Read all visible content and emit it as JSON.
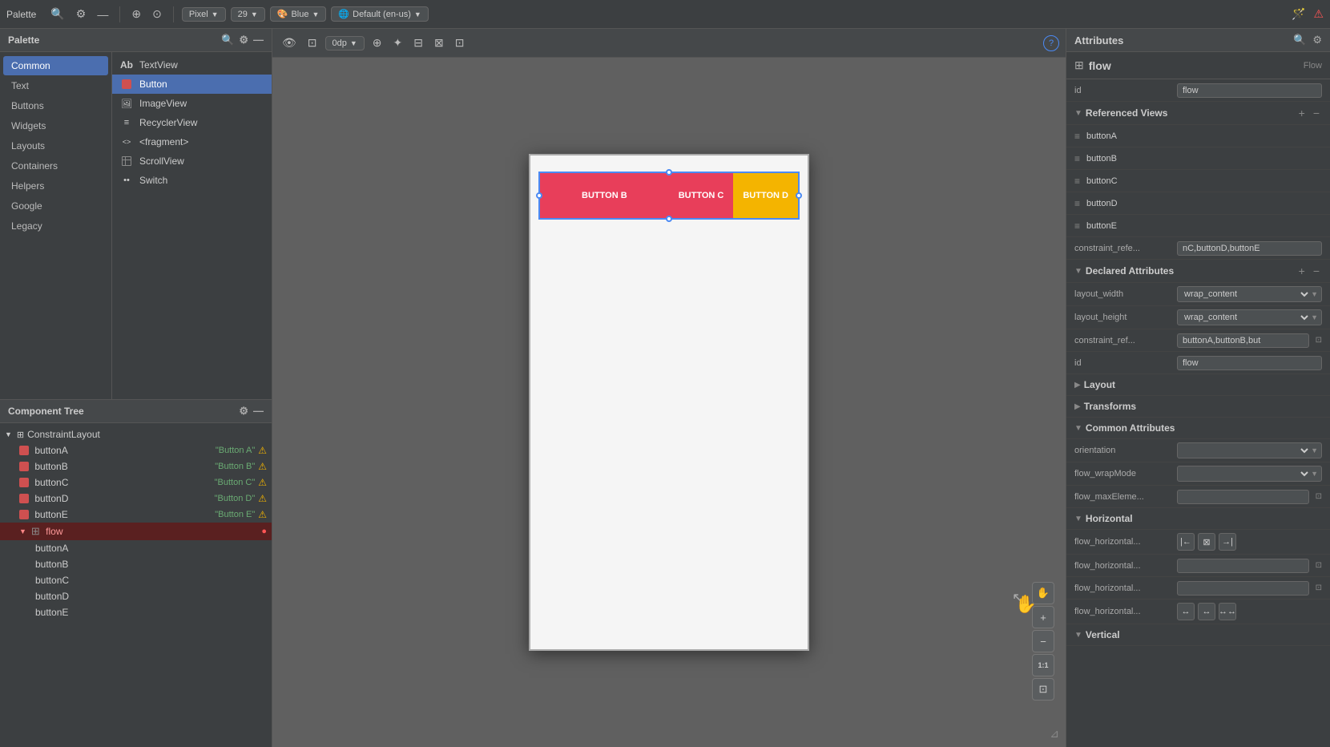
{
  "topbar": {
    "title": "Palette",
    "tools": {
      "pixel_label": "Pixel",
      "zoom_label": "29",
      "theme_label": "Blue",
      "locale_label": "Default (en-us)",
      "help_icon": "?",
      "error_icon": "⚠"
    }
  },
  "palette": {
    "categories": [
      {
        "id": "common",
        "label": "Common",
        "active": true
      },
      {
        "id": "text",
        "label": "Text"
      },
      {
        "id": "buttons",
        "label": "Buttons"
      },
      {
        "id": "widgets",
        "label": "Widgets"
      },
      {
        "id": "layouts",
        "label": "Layouts"
      },
      {
        "id": "containers",
        "label": "Containers"
      },
      {
        "id": "helpers",
        "label": "Helpers"
      },
      {
        "id": "google",
        "label": "Google"
      },
      {
        "id": "legacy",
        "label": "Legacy"
      }
    ],
    "items": [
      {
        "id": "textview",
        "label": "TextView",
        "icon": "Ab"
      },
      {
        "id": "button",
        "label": "Button",
        "icon": "▣",
        "selected": true
      },
      {
        "id": "imageview",
        "label": "ImageView",
        "icon": "🖼"
      },
      {
        "id": "recyclerview",
        "label": "RecyclerView",
        "icon": "≡"
      },
      {
        "id": "fragment",
        "label": "<fragment>",
        "icon": "<>"
      },
      {
        "id": "scrollview",
        "label": "ScrollView",
        "icon": "▣"
      },
      {
        "id": "switch",
        "label": "Switch",
        "icon": "••"
      }
    ]
  },
  "component_tree": {
    "title": "Component Tree",
    "items": [
      {
        "id": "constraint_layout",
        "label": "ConstraintLayout",
        "indent": 0,
        "icon": "constraint",
        "has_chevron": true
      },
      {
        "id": "buttonA",
        "label": "buttonA",
        "string": "\"Button A\"",
        "indent": 1,
        "icon": "red",
        "warning": true
      },
      {
        "id": "buttonB",
        "label": "buttonB",
        "string": "\"Button B\"",
        "indent": 1,
        "icon": "red",
        "warning": true
      },
      {
        "id": "buttonC",
        "label": "buttonC",
        "string": "\"Button C\"",
        "indent": 1,
        "icon": "red",
        "warning": true
      },
      {
        "id": "buttonD",
        "label": "buttonD",
        "string": "\"Button D\"",
        "indent": 1,
        "icon": "red",
        "warning": true
      },
      {
        "id": "buttonE",
        "label": "buttonE",
        "string": "\"Button E\"",
        "indent": 1,
        "icon": "red",
        "warning": true
      },
      {
        "id": "flow",
        "label": "flow",
        "indent": 1,
        "icon": "flow",
        "error": true,
        "selected": true,
        "has_chevron": true
      },
      {
        "id": "flow_buttonA",
        "label": "buttonA",
        "indent": 2
      },
      {
        "id": "flow_buttonB",
        "label": "buttonB",
        "indent": 2
      },
      {
        "id": "flow_buttonC",
        "label": "buttonC",
        "indent": 2
      },
      {
        "id": "flow_buttonD",
        "label": "buttonD",
        "indent": 2
      },
      {
        "id": "flow_buttonE",
        "label": "buttonE",
        "indent": 2
      }
    ]
  },
  "canvas": {
    "buttons": [
      {
        "label": "BUTTON B",
        "color": "red"
      },
      {
        "label": "BUTTON C",
        "color": "red"
      },
      {
        "label": "BUTTON D",
        "color": "yellow"
      }
    ]
  },
  "attributes": {
    "panel_title": "Attributes",
    "component_name": "flow",
    "component_type": "Flow",
    "id_label": "id",
    "id_value": "flow",
    "referenced_views": {
      "title": "Referenced Views",
      "items": [
        "buttonA",
        "buttonB",
        "buttonC",
        "buttonD",
        "buttonE"
      ],
      "constraint_ref_label": "constraint_refe...",
      "constraint_ref_value": "nC,buttonD,buttonE"
    },
    "declared_attrs": {
      "title": "Declared Attributes",
      "rows": [
        {
          "label": "layout_width",
          "value": "wrap_content",
          "type": "select"
        },
        {
          "label": "layout_height",
          "value": "wrap_content",
          "type": "select"
        },
        {
          "label": "constraint_ref...",
          "value": "buttonA,buttonB,but",
          "type": "input"
        },
        {
          "label": "id",
          "value": "flow",
          "type": "input"
        }
      ]
    },
    "layout": {
      "title": "Layout"
    },
    "transforms": {
      "title": "Transforms"
    },
    "common_attributes": {
      "title": "Common Attributes",
      "rows": [
        {
          "label": "orientation",
          "value": "",
          "type": "select"
        },
        {
          "label": "flow_wrapMode",
          "value": "",
          "type": "select"
        },
        {
          "label": "flow_maxEleme...",
          "value": "",
          "type": "input"
        }
      ]
    },
    "horizontal": {
      "title": "Horizontal",
      "rows": [
        {
          "label": "flow_horizontal...",
          "value": "",
          "type": "icon-picker"
        },
        {
          "label": "flow_horizontal...",
          "value": "",
          "type": "input"
        },
        {
          "label": "flow_horizontal...",
          "value": "",
          "type": "input"
        },
        {
          "label": "flow_horizontal...",
          "value": "",
          "type": "arrows"
        }
      ]
    },
    "vertical": {
      "title": "Vertical"
    }
  }
}
